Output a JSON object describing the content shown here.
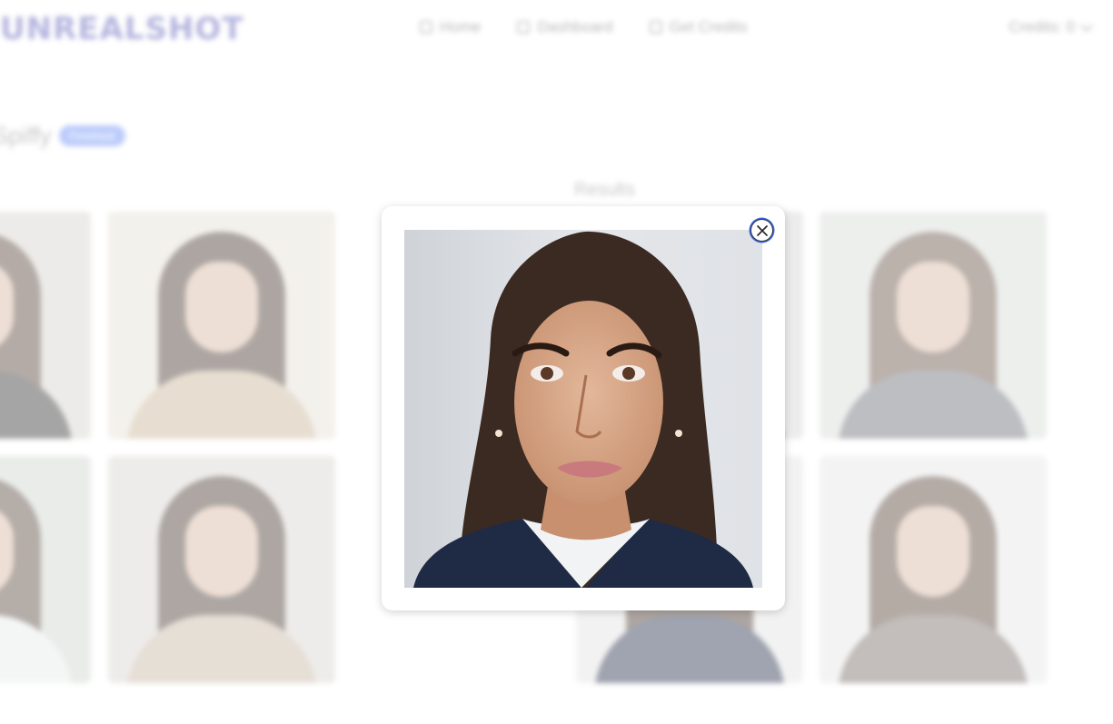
{
  "app": {
    "logo_text": "UNREALSHOT"
  },
  "nav": {
    "items": [
      {
        "label": "Home",
        "icon": "home-icon"
      },
      {
        "label": "Dashboard",
        "icon": "dashboard-icon"
      },
      {
        "label": "Get Credits",
        "icon": "credit-card-icon"
      }
    ],
    "credits_label": "Credits: 0"
  },
  "page": {
    "title": "Spiffy",
    "badge": "Finished",
    "results_label": "Results"
  },
  "modal": {
    "close_icon": "close-icon",
    "image_alt": "Generated professional headshot of a woman in a navy blazer"
  },
  "colors": {
    "accent": "#6b8ff7",
    "focus_ring": "#3b66e0"
  }
}
